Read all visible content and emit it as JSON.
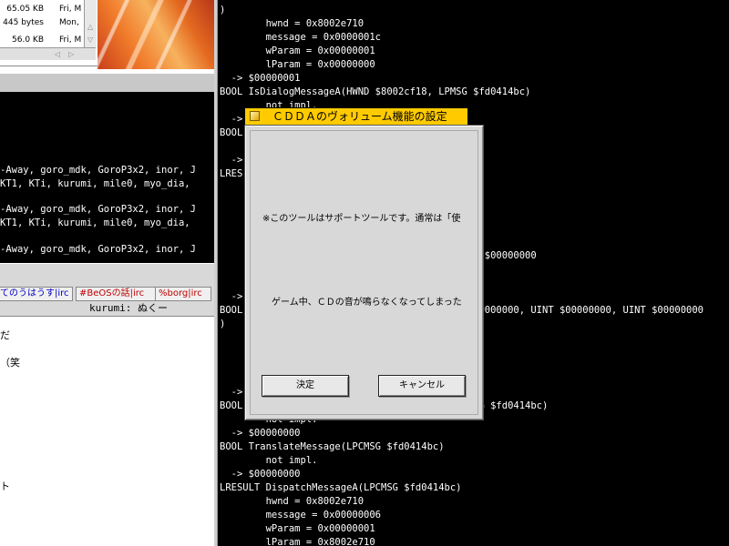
{
  "file_list": {
    "rows": [
      {
        "size": "65.05 KB",
        "date": "Fri, M"
      },
      {
        "size": "445 bytes",
        "date": "Mon,"
      },
      {
        "size": "56.0 KB",
        "date": "Fri, M"
      }
    ]
  },
  "irc": {
    "log_lines": [
      "-Away, goro_mdk, GoroP3x2, inor, J",
      "KT1, KTi, kurumi, mile0, myo_dia,",
      "-Away, goro_mdk, GoroP3x2, inor, J",
      "KT1, KTi, kurumi, mile0, myo_dia,",
      "-Away, goro_mdk, GoroP3x2, inor, J"
    ],
    "tabs": [
      "てのうはうす|irc",
      "#BeOSの話|irc",
      "%borg|irc"
    ],
    "status_text": "kurumi: ぬくー",
    "chat_lines": [
      "だ",
      "（笑",
      "ト"
    ]
  },
  "terminal": {
    "lines": [
      ")",
      "        hwnd = 0x8002e710",
      "        message = 0x0000001c",
      "        wParam = 0x00000001",
      "        lParam = 0x00000000",
      "  -> $00000001",
      "BOOL IsDialogMessageA(HWND $8002cf18, LPMSG $fd0414bc)",
      "        not impl.",
      "  ->",
      "BOOL",
      "",
      "  ->",
      "LRES",
      "",
      "",
      "",
      "",
      "",
      "                                            / $00000000",
      "",
      "",
      "  ->",
      "BOOL                                         0000000, UINT $00000000, UINT $00000000",
      ")",
      "",
      "",
      "",
      "",
      "  ->",
      "BOOL                                         G $fd0414bc)",
      "        not impl.",
      "  -> $00000000",
      "BOOL TranslateMessage(LPCMSG $fd0414bc)",
      "        not impl.",
      "  -> $00000000",
      "LRESULT DispatchMessageA(LPCMSG $fd0414bc)",
      "        hwnd = 0x8002e710",
      "        message = 0x00000006",
      "        wParam = 0x00000001",
      "        lParam = 0x8002e710"
    ]
  },
  "dialog": {
    "title": "ＣＤＤＡのヴォリューム機能の設定",
    "text1": "※このツールはサポートツールです。通常は「使",
    "text2": "ゲーム中、ＣＤの音が鳴らなくなってしまった",
    "ok_label": "決定",
    "cancel_label": "キャンセル"
  },
  "colors": {
    "dialog_title_bg": "#ffcb00",
    "terminal_bg": "#000000",
    "terminal_fg": "#ffffff",
    "tab_text": "#c00000"
  }
}
